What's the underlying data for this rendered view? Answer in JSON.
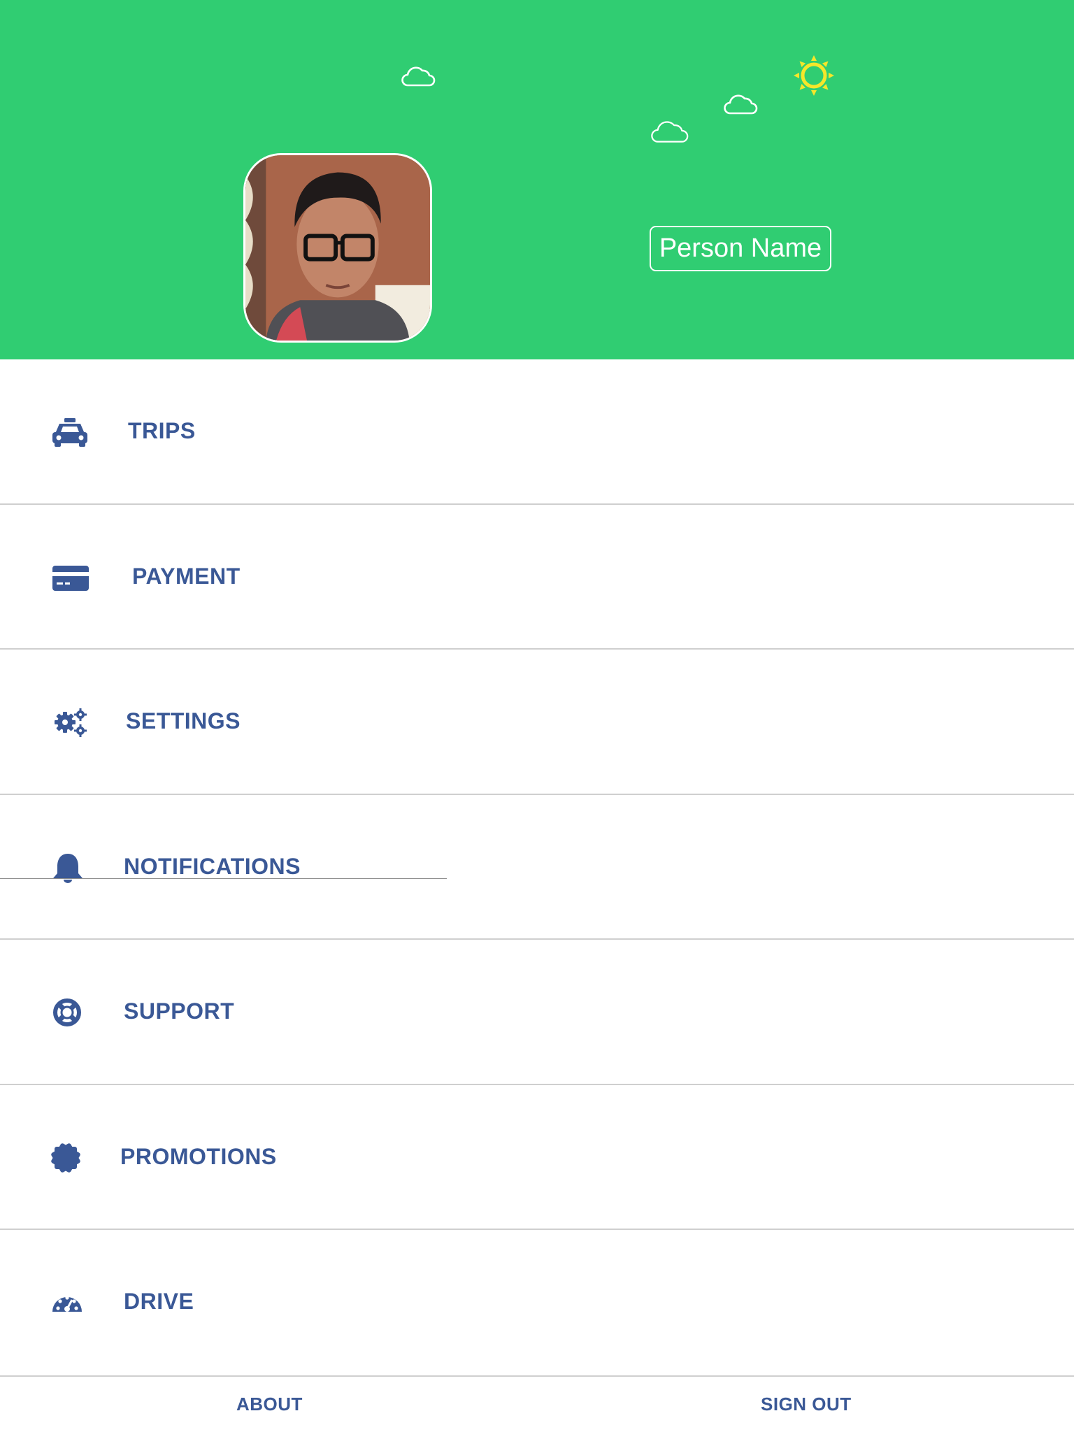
{
  "header": {
    "background_color": "#30cd72",
    "person_name": "Person Name",
    "avatar_alt": "Profile photo",
    "decorations": [
      "cloud-icon",
      "cloud-icon",
      "cloud-icon",
      "sun-icon"
    ]
  },
  "menu": {
    "items": [
      {
        "label": "TRIPS",
        "icon": "taxi-icon"
      },
      {
        "label": "PAYMENT",
        "icon": "credit-card-icon"
      },
      {
        "label": "SETTINGS",
        "icon": "gears-icon"
      },
      {
        "label": "NOTIFICATIONS",
        "icon": "bell-icon"
      },
      {
        "label": "SUPPORT",
        "icon": "life-ring-icon"
      },
      {
        "label": "PROMOTIONS",
        "icon": "badge-icon"
      },
      {
        "label": "DRIVE",
        "icon": "speedometer-icon"
      }
    ]
  },
  "footer": {
    "about_label": "ABOUT",
    "sign_out_label": "SIGN OUT"
  },
  "colors": {
    "accent_green": "#30cd72",
    "menu_text": "#3a5896",
    "sun": "#f5e72a",
    "divider": "#cfcfcf"
  }
}
